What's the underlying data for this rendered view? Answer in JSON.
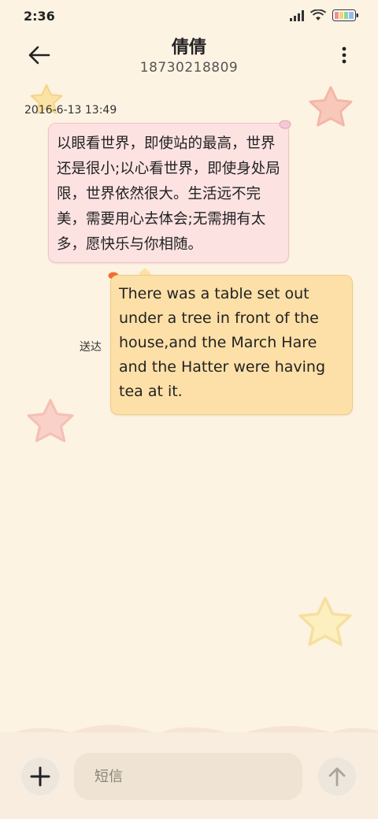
{
  "status_bar": {
    "time": "2:36"
  },
  "header": {
    "contact_name": "倩倩",
    "contact_number": "18730218809"
  },
  "conversation": {
    "timestamp": "2016-6-13 13:49",
    "messages": [
      {
        "direction": "incoming",
        "text": "以眼看世界，即使站的最高，世界还是很小;以心看世界，即使身处局限，世界依然很大。生活远不完美，需要用心去体会;无需拥有太多，愿快乐与你相随。"
      },
      {
        "direction": "outgoing",
        "text": "There was a table set out under a tree in front of the house,and the March Hare and the Hatter were having tea at it.",
        "status": "送达"
      }
    ]
  },
  "composer": {
    "placeholder": "短信"
  },
  "colors": {
    "background": "#fdf3e3",
    "incoming_bubble": "#fde2e2",
    "outgoing_bubble": "#fde0a8"
  }
}
